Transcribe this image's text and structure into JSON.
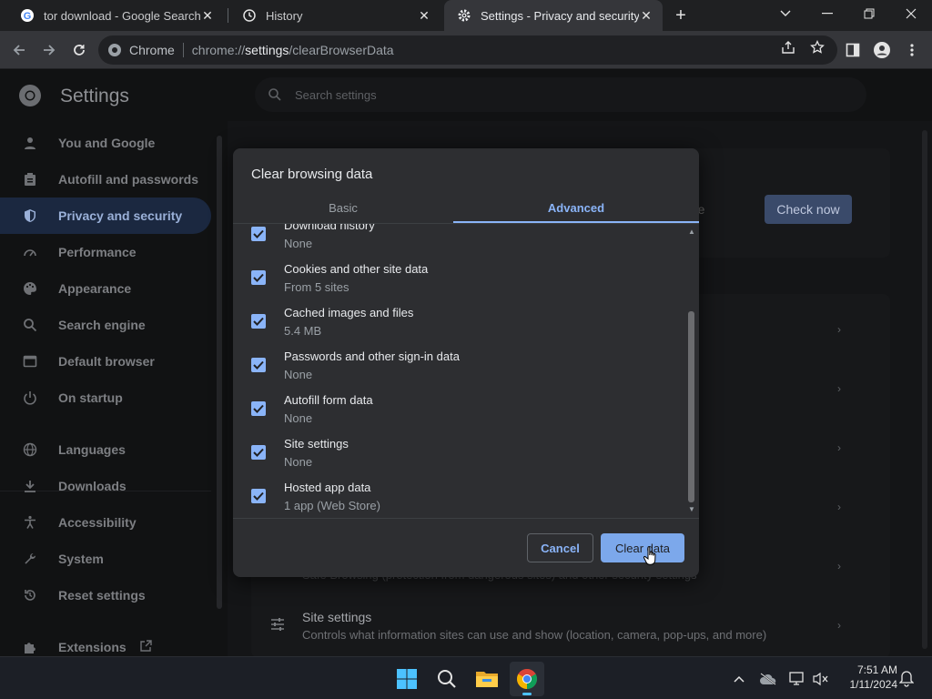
{
  "tabs": [
    {
      "label": "tor download - Google Search",
      "icon": "google-icon"
    },
    {
      "label": "History",
      "icon": "history-icon"
    },
    {
      "label": "Settings - Privacy and security",
      "icon": "gear-icon"
    }
  ],
  "window_controls": {
    "minimize": "minimize-icon",
    "maximize": "restore-icon",
    "close": "close-icon"
  },
  "omnibox": {
    "chip": "Chrome",
    "url_prefix": "chrome://",
    "url_host": "settings",
    "url_path": "/clearBrowserData"
  },
  "settings": {
    "title": "Settings",
    "search_placeholder": "Search settings",
    "sidebar": [
      {
        "label": "You and Google",
        "icon": "person-icon"
      },
      {
        "label": "Autofill and passwords",
        "icon": "clipboard-icon"
      },
      {
        "label": "Privacy and security",
        "icon": "shield-icon",
        "selected": true
      },
      {
        "label": "Performance",
        "icon": "speedometer-icon"
      },
      {
        "label": "Appearance",
        "icon": "palette-icon"
      },
      {
        "label": "Search engine",
        "icon": "search-icon"
      },
      {
        "label": "Default browser",
        "icon": "browser-icon"
      },
      {
        "label": "On startup",
        "icon": "power-icon"
      },
      {
        "label": "Languages",
        "icon": "globe-icon"
      },
      {
        "label": "Downloads",
        "icon": "download-icon"
      },
      {
        "label": "Accessibility",
        "icon": "accessibility-icon"
      },
      {
        "label": "System",
        "icon": "wrench-icon"
      },
      {
        "label": "Reset settings",
        "icon": "reset-icon"
      },
      {
        "label": "Extensions",
        "icon": "puzzle-icon"
      }
    ],
    "check_now": "Check now",
    "peek_text": "re",
    "under_text": "Safe Browsing (protection from dangerous sites) and other security settings",
    "site_settings": {
      "title": "Site settings",
      "subtitle": "Controls what information sites can use and show (location, camera, pop-ups, and more)"
    }
  },
  "dialog": {
    "title": "Clear browsing data",
    "tab_basic": "Basic",
    "tab_advanced": "Advanced",
    "options": [
      {
        "title": "Download history",
        "subtitle": "None",
        "checked": true
      },
      {
        "title": "Cookies and other site data",
        "subtitle": "From 5 sites",
        "checked": true
      },
      {
        "title": "Cached images and files",
        "subtitle": "5.4 MB",
        "checked": true
      },
      {
        "title": "Passwords and other sign-in data",
        "subtitle": "None",
        "checked": true
      },
      {
        "title": "Autofill form data",
        "subtitle": "None",
        "checked": true
      },
      {
        "title": "Site settings",
        "subtitle": "None",
        "checked": true
      },
      {
        "title": "Hosted app data",
        "subtitle": "1 app (Web Store)",
        "checked": true
      }
    ],
    "cancel_label": "Cancel",
    "clear_label": "Clear data"
  },
  "taskbar": {
    "time": "7:51 AM",
    "date": "1/11/2024"
  },
  "colors": {
    "accent": "#8ab4f8",
    "primary_button": "#7ca8eb"
  }
}
